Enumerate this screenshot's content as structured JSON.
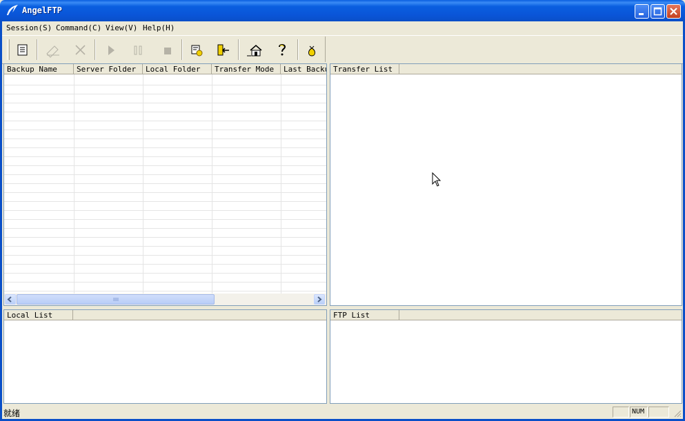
{
  "window": {
    "title": "AngelFTP"
  },
  "menu": [
    {
      "label": "Session(S)"
    },
    {
      "label": "Command(C)"
    },
    {
      "label": "View(V)"
    },
    {
      "label": "Help(H)"
    }
  ],
  "toolbar": [
    {
      "icon": "new-session-icon",
      "enabled": true
    },
    {
      "icon": "edit-icon",
      "enabled": false
    },
    {
      "icon": "delete-icon",
      "enabled": false
    },
    {
      "icon": "play-icon",
      "enabled": false
    },
    {
      "icon": "pause-icon",
      "enabled": false
    },
    {
      "icon": "stop-icon",
      "enabled": false
    },
    {
      "icon": "settings-icon",
      "enabled": true
    },
    {
      "icon": "exit-icon",
      "enabled": true
    },
    {
      "icon": "home-icon",
      "enabled": true
    },
    {
      "icon": "help-icon",
      "enabled": true
    },
    {
      "icon": "donate-icon",
      "enabled": true
    }
  ],
  "backup_table": {
    "columns": [
      "Backup Name",
      "Server Folder",
      "Local Folder",
      "Transfer Mode",
      "Last Backup"
    ]
  },
  "transfer_list": {
    "columns": [
      "Transfer List",
      ""
    ]
  },
  "local_list": {
    "columns": [
      "Local List",
      ""
    ]
  },
  "ftp_list": {
    "columns": [
      "FTP List",
      ""
    ]
  },
  "status": {
    "text": "就绪",
    "num": "NUM"
  },
  "colors": {
    "titlebar": "#0a5fe0",
    "chrome": "#ece9d8",
    "border": "#7f9db9"
  }
}
